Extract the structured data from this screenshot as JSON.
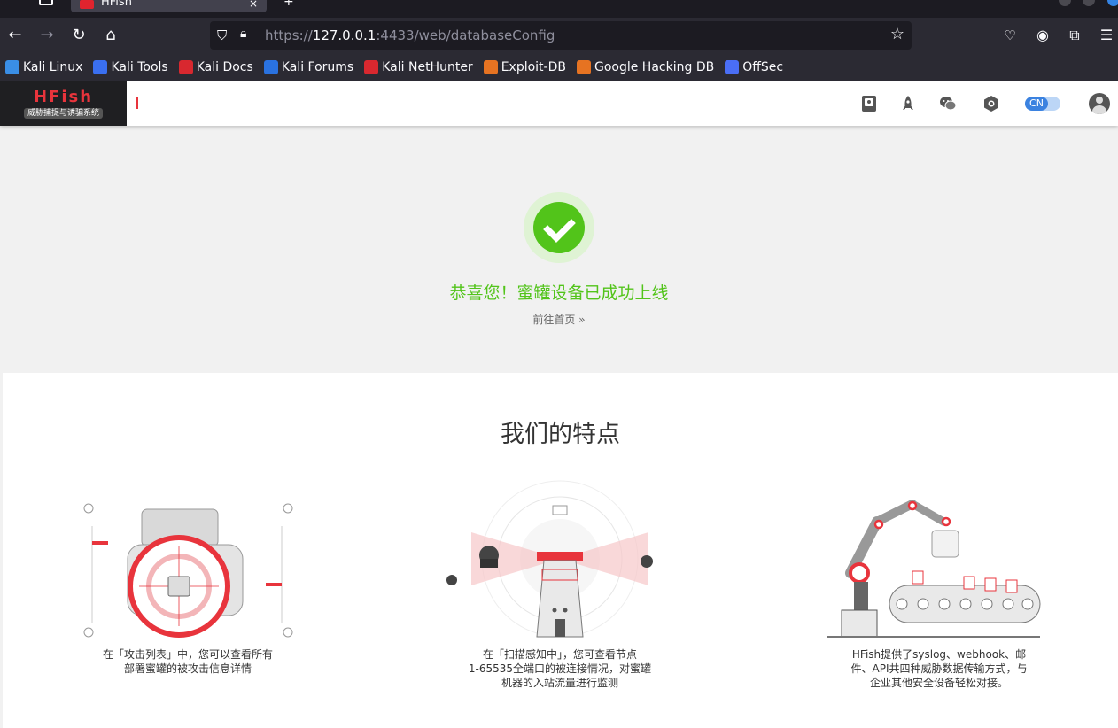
{
  "browser": {
    "tab_title": "HFish",
    "tab_close": "×",
    "new_tab": "+",
    "url_prefix": "https://",
    "url_host": "127.0.0.1",
    "url_rest": ":4433/web/databaseConfig",
    "bookmarks": [
      {
        "label": "Kali Linux",
        "color": "#3a8ee6"
      },
      {
        "label": "Kali Tools",
        "color": "#3a6ff0"
      },
      {
        "label": "Kali Docs",
        "color": "#d8282f"
      },
      {
        "label": "Kali Forums",
        "color": "#2a72e0"
      },
      {
        "label": "Kali NetHunter",
        "color": "#d8282f"
      },
      {
        "label": "Exploit-DB",
        "color": "#e67322"
      },
      {
        "label": "Google Hacking DB",
        "color": "#e67322"
      },
      {
        "label": "OffSec",
        "color": "#4a6ef5"
      }
    ]
  },
  "app": {
    "logo_name": "HFish",
    "logo_sub": "威胁捕捉与诱骗系统",
    "lang": "CN",
    "accent": "#e8343c"
  },
  "success": {
    "message": "恭喜您！蜜罐设备已成功上线",
    "link": "前往首页",
    "link_arrow": "»",
    "color": "#52c41a"
  },
  "features": {
    "title": "我们的特点",
    "items": [
      {
        "line1": "在「攻击列表」中，您可以查看所有",
        "line2": "部署蜜罐的被攻击信息详情",
        "line3": ""
      },
      {
        "line1": "在「扫描感知中」，您可查看节点",
        "line2": "1-65535全端口的被连接情况，对蜜罐",
        "line3": "机器的入站流量进行监测"
      },
      {
        "line1": "HFish提供了syslog、webhook、邮",
        "line2": "件、API共四种威胁数据传输方式，与",
        "line3": "企业其他安全设备轻松对接。"
      }
    ]
  }
}
